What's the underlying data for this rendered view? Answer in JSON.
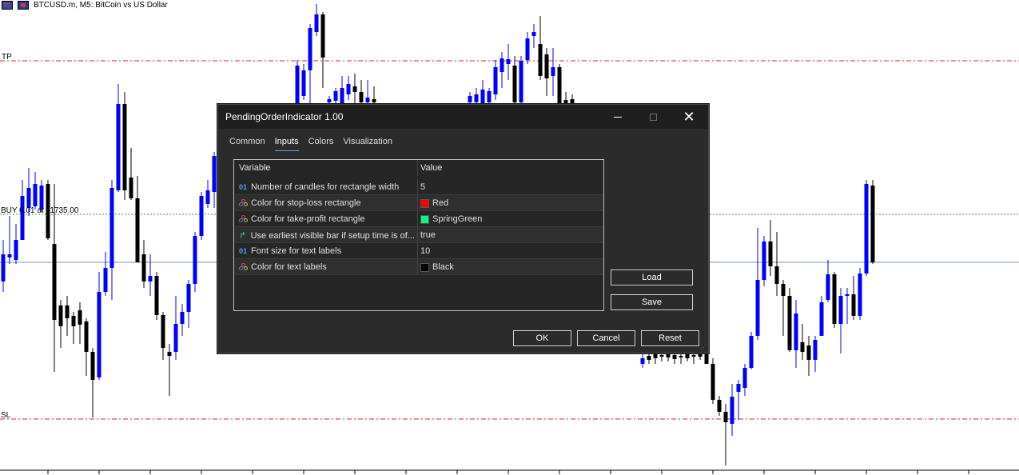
{
  "chart": {
    "symbol_label": "BTCUSD.m, M5:  BitCoin vs US Dollar",
    "levels": {
      "tp": "TP",
      "buy": "BUY 0.01 at 11735.00",
      "sl": "SL"
    },
    "colors": {
      "bull": "#0000ff",
      "bear": "#000000",
      "tp_sl_line": "#e0202a",
      "buy_line": "#3aa33a",
      "bid_line": "#7a94c0"
    }
  },
  "dialog": {
    "title": "PendingOrderIndicator 1.00",
    "tabs": [
      {
        "label": "Common"
      },
      {
        "label": "Inputs"
      },
      {
        "label": "Colors"
      },
      {
        "label": "Visualization"
      }
    ],
    "active_tab": "Inputs",
    "grid": {
      "headers": {
        "variable": "Variable",
        "value": "Value"
      },
      "rows": [
        {
          "icon": "numeric-icon",
          "icon_glyph": "01",
          "variable": "Number of candles for rectangle width",
          "value": "5"
        },
        {
          "icon": "color-icon",
          "variable": "Color for stop-loss rectangle",
          "value": "Red",
          "swatch": "#ff0000"
        },
        {
          "icon": "color-icon",
          "variable": "Color for take-profit rectangle",
          "value": "SpringGreen",
          "swatch": "#00ff7f"
        },
        {
          "icon": "boolean-icon",
          "icon_glyph": "↱",
          "variable": "Use earliest visible bar if setup time is of...",
          "value": "true"
        },
        {
          "icon": "numeric-icon",
          "icon_glyph": "01",
          "variable": "Font size for text labels",
          "value": "10"
        },
        {
          "icon": "color-icon",
          "variable": "Color for text labels",
          "value": "Black",
          "swatch": "#000000"
        }
      ]
    },
    "buttons": {
      "load": "Load",
      "save": "Save",
      "ok": "OK",
      "cancel": "Cancel",
      "reset": "Reset"
    }
  }
}
